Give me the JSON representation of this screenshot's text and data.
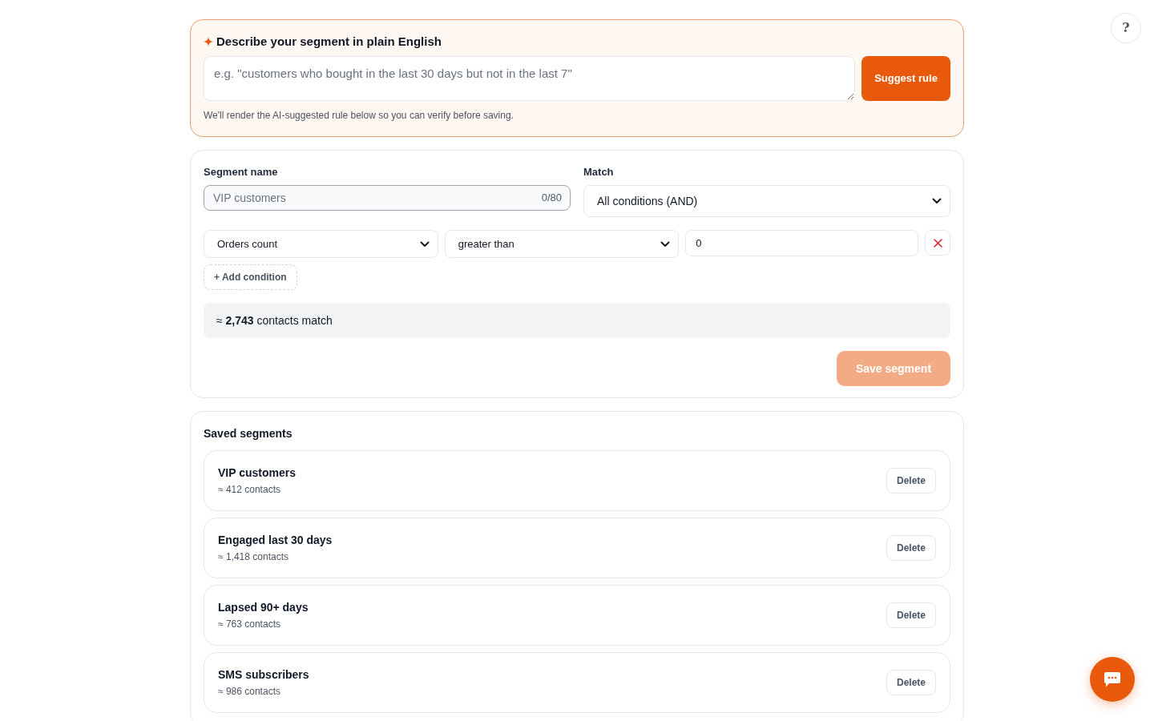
{
  "help_button": {
    "label": "?"
  },
  "ai_prompt": {
    "title": "Describe your segment in plain English",
    "placeholder": "e.g. \"customers who bought in the last 30 days but not in the last 7\"",
    "button": "Suggest rule",
    "hint": "We'll render the AI-suggested rule below so you can verify before saving."
  },
  "segment_form": {
    "name_field": {
      "label": "Segment name",
      "placeholder": "VIP customers",
      "counter": "0/80"
    },
    "match_field": {
      "label": "Match",
      "value": "All conditions (AND)"
    },
    "conditions": [
      {
        "field": "Orders count",
        "operator": "greater than",
        "value": "0"
      }
    ],
    "add_condition": "+ Add condition",
    "match_summary": "≈ **2,743** contacts match",
    "save_button": {
      "label": "Save segment",
      "disabled": true
    }
  },
  "saved_segments": {
    "title": "Saved segments",
    "items": [
      {
        "name": "VIP customers",
        "count": "≈ 412 contacts",
        "action": "Delete"
      },
      {
        "name": "Engaged last 30 days",
        "count": "≈ 1,418 contacts",
        "action": "Delete"
      },
      {
        "name": "Lapsed 90+ days",
        "count": "≈ 763 contacts",
        "action": "Delete"
      },
      {
        "name": "SMS subscribers",
        "count": "≈ 986 contacts",
        "action": "Delete"
      }
    ]
  }
}
